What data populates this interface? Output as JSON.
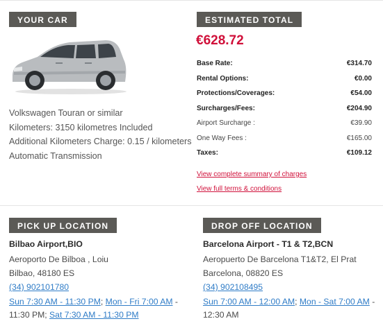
{
  "your_car": {
    "tag": "YOUR CAR",
    "model": "Volkswagen Touran or similar",
    "kilometers": "Kilometers: 3150 kilometres Included",
    "additional_km": "Additional Kilometers Charge: 0.15 / kilometers",
    "transmission": "Automatic Transmission",
    "image_icon": "car-image",
    "car_color": "#b9bcbf"
  },
  "estimated_total": {
    "tag": "ESTIMATED TOTAL",
    "amount": "€628.72",
    "charges": [
      {
        "label": "Base Rate:",
        "value": "€314.70",
        "style": "bold"
      },
      {
        "label": "Rental Options:",
        "value": "€0.00",
        "style": "bold"
      },
      {
        "label": "Protections/Coverages:",
        "value": "€54.00",
        "style": "bold"
      },
      {
        "label": "Surcharges/Fees:",
        "value": "€204.90",
        "style": "bold"
      },
      {
        "label": "Airport Surcharge :",
        "value": "€39.90",
        "style": "light"
      },
      {
        "label": "One Way Fees :",
        "value": "€165.00",
        "style": "light"
      },
      {
        "label": "Taxes:",
        "value": "€109.12",
        "style": "bold"
      }
    ],
    "summary_link": "View complete summary of charges",
    "terms_link": "View full terms & conditions"
  },
  "pickup": {
    "tag": "PICK UP LOCATION",
    "name": "Bilbao Airport,BIO",
    "address1": "Aeroporto De Bilboa , Loiu",
    "address2": "Bilbao, 48180 ES",
    "phone": "(34) 902101780",
    "hours": [
      {
        "text": "Sun 7:30 AM - 11:30 PM",
        "link": true
      },
      {
        "text": "; ",
        "link": false
      },
      {
        "text": "Mon - Fri 7:00 AM",
        "link": true
      },
      {
        "text": " - 11:30 PM; ",
        "link": false
      },
      {
        "text": "Sat 7:30 AM - 11:30 PM",
        "link": true
      }
    ]
  },
  "dropoff": {
    "tag": "DROP OFF LOCATION",
    "name": "Barcelona Airport - T1 & T2,BCN",
    "address1": "Aeropuerto De Barcelona T1&T2, El Prat",
    "address2": "Barcelona, 08820 ES",
    "phone": "(34) 902108495",
    "hours": [
      {
        "text": "Sun 7:00 AM - 12:00 AM",
        "link": true
      },
      {
        "text": "; ",
        "link": false
      },
      {
        "text": "Mon - Sat 7:00 AM",
        "link": true
      },
      {
        "text": " - 12:30 AM",
        "link": false
      }
    ]
  },
  "colors": {
    "accent": "#d0103a",
    "tag_bg": "#5b5a56",
    "link": "#2f7cc7"
  }
}
